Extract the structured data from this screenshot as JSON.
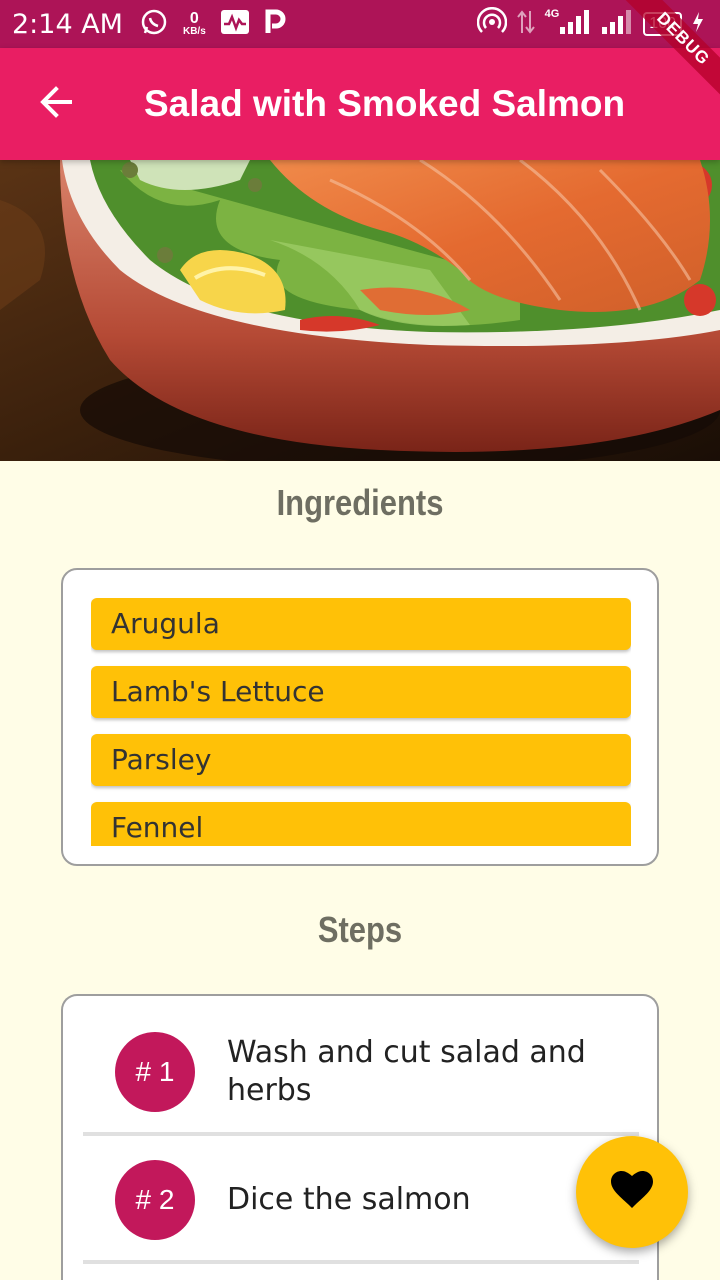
{
  "status_bar": {
    "time": "2:14 AM",
    "data_speed_value": "0",
    "data_speed_unit": "KB/s",
    "network": "4G",
    "battery": "100"
  },
  "debug_banner": "DEBUG",
  "app_bar": {
    "title": "Salad with Smoked Salmon",
    "back_icon": "arrow-back-icon"
  },
  "ingredients": {
    "title": "Ingredients",
    "items": [
      "Arugula",
      "Lamb's Lettuce",
      "Parsley",
      "Fennel"
    ]
  },
  "steps": {
    "title": "Steps",
    "items": [
      {
        "number": "# 1",
        "text": "Wash and cut salad and herbs"
      },
      {
        "number": "# 2",
        "text": "Dice the salmon"
      }
    ]
  },
  "fab": {
    "icon": "heart-icon"
  },
  "colors": {
    "status_bar": "#AD1457",
    "app_bar": "#E91E63",
    "background": "#FFFDE7",
    "ingredient_chip": "#FFC107",
    "step_badge": "#C2185B",
    "fab": "#FFC107"
  }
}
